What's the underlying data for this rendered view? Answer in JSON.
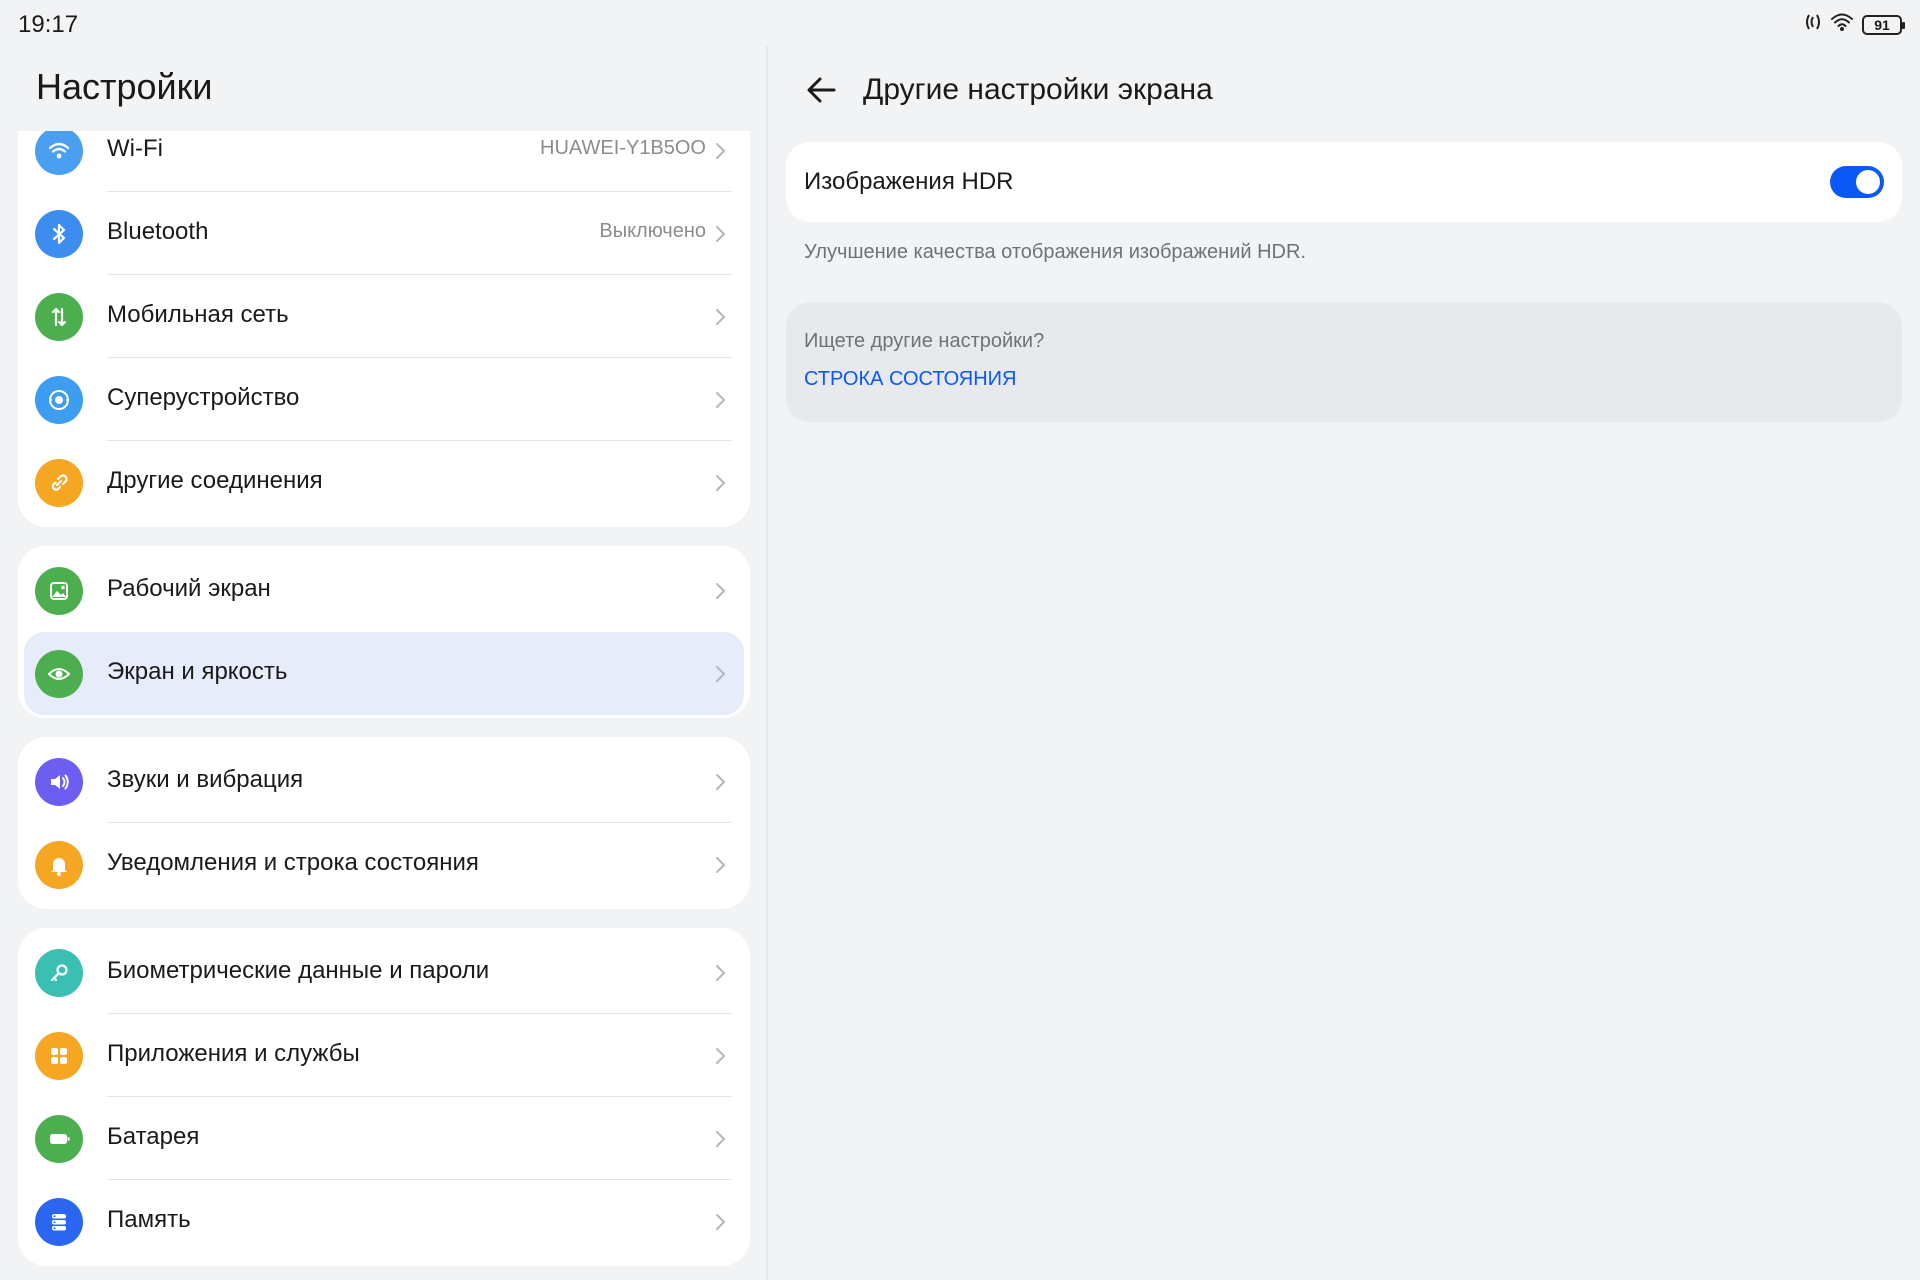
{
  "status": {
    "time": "19:17",
    "battery": "91",
    "icons": [
      "nfc-icon",
      "wifi-icon",
      "battery-icon"
    ]
  },
  "left": {
    "title": "Настройки",
    "groups": [
      {
        "items": [
          {
            "label": "Wi-Fi",
            "value": "HUAWEI-Y1B5OO",
            "icon": "wifi-icon",
            "color": "#4a9ff0"
          },
          {
            "label": "Bluetooth",
            "value": "Выключено",
            "icon": "bluetooth-icon",
            "color": "#3d8df0"
          },
          {
            "label": "Мобильная сеть",
            "value": "",
            "icon": "cellular-icon",
            "color": "#4cae4f"
          },
          {
            "label": "Суперустройство",
            "value": "",
            "icon": "super-device-icon",
            "color": "#3d9df0"
          },
          {
            "label": "Другие соединения",
            "value": "",
            "icon": "link-icon",
            "color": "#f5a623"
          }
        ]
      },
      {
        "items": [
          {
            "label": "Рабочий экран",
            "value": "",
            "icon": "wallpaper-icon",
            "color": "#4cae4f"
          },
          {
            "label": "Экран и яркость",
            "value": "",
            "icon": "eye-icon",
            "color": "#4cae4f",
            "selected": true
          }
        ]
      },
      {
        "items": [
          {
            "label": "Звуки и вибрация",
            "value": "",
            "icon": "speaker-icon",
            "color": "#6b5ef0"
          },
          {
            "label": "Уведомления и строка состояния",
            "value": "",
            "icon": "bell-icon",
            "color": "#f5a623"
          }
        ]
      },
      {
        "items": [
          {
            "label": "Биометрические данные и пароли",
            "value": "",
            "icon": "key-icon",
            "color": "#3bbfb3"
          },
          {
            "label": "Приложения и службы",
            "value": "",
            "icon": "apps-icon",
            "color": "#f5a623"
          },
          {
            "label": "Батарея",
            "value": "",
            "icon": "battery-icon",
            "color": "#4cae4f"
          },
          {
            "label": "Память",
            "value": "",
            "icon": "storage-icon",
            "color": "#2a66f0"
          }
        ]
      }
    ]
  },
  "right": {
    "title": "Другие настройки экрана",
    "hdr": {
      "label": "Изображения HDR",
      "enabled": true,
      "description": "Улучшение качества отображения изображений HDR."
    },
    "more": {
      "title": "Ищете другие настройки?",
      "link": "СТРОКА СОСТОЯНИЯ"
    }
  },
  "colors": {
    "accent": "#0a59f7",
    "selected_bg": "#e6ecfa",
    "page_bg": "#f1f3f5"
  }
}
